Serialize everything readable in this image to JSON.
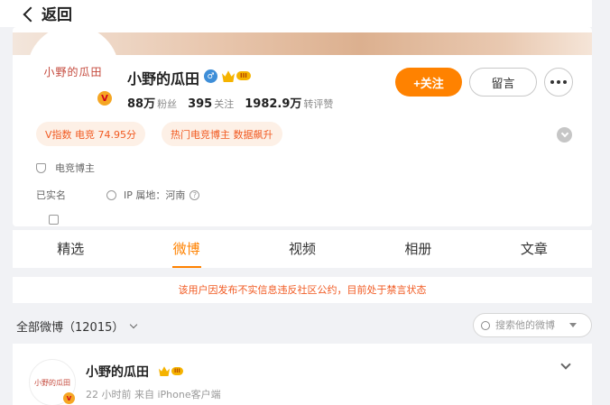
{
  "nav": {
    "back_label": "返回"
  },
  "profile": {
    "avatar_text": "小野的瓜田",
    "name": "小野的瓜田",
    "gender_symbol": "♂",
    "verified_symbol": "V",
    "level": "III",
    "stats": [
      {
        "value": "88万",
        "label": "粉丝"
      },
      {
        "value": "395",
        "label": "关注"
      },
      {
        "value": "1982.9万",
        "label": "转评赞"
      }
    ],
    "follow_label": "+关注",
    "message_label": "留言",
    "tags": [
      "V指数 电竞 74.95分",
      "热门电竞博主 数据飙升"
    ],
    "category": "电竞博主",
    "realname": "已实名",
    "ip_location": "IP 属地：河南",
    "help_symbol": "?"
  },
  "tabs": [
    "精选",
    "微博",
    "视频",
    "相册",
    "文章"
  ],
  "active_tab": "微博",
  "notice": "该用户因发布不实信息违反社区公约，目前处于禁言状态",
  "filter": {
    "label": "全部微博（12015）"
  },
  "search": {
    "placeholder": "搜索他的微博"
  },
  "post": {
    "avatar_text": "小野的瓜田",
    "author": "小野的瓜田",
    "level": "III",
    "meta": "22 小时前  来自 iPhone客户端"
  },
  "colors": {
    "accent": "#ff8200",
    "warning": "#f15a22",
    "tag_bg": "#fdf0e6"
  }
}
